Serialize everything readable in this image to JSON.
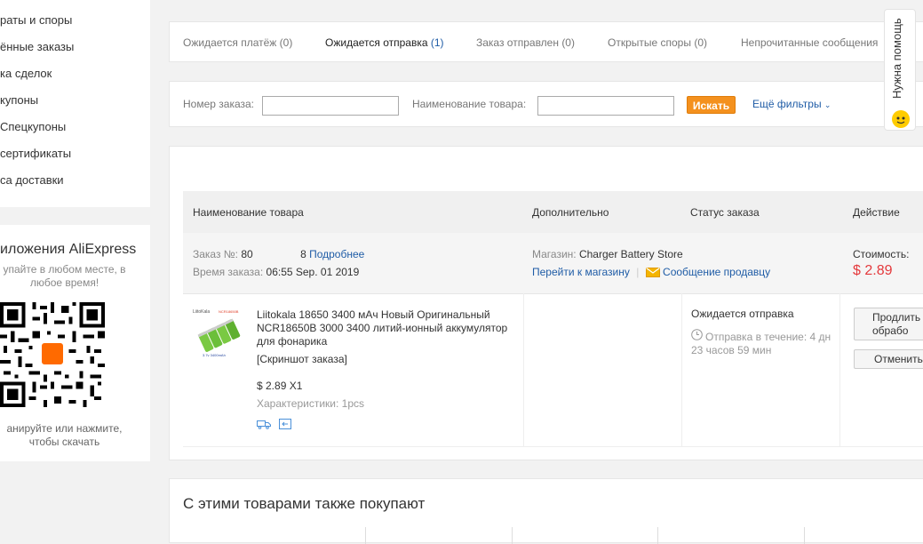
{
  "sidebar": {
    "menu_items": [
      "раты и споры",
      "ённые заказы",
      "ка сделок",
      "купоны",
      "Спецкупоны",
      "сертификаты",
      "са доставки"
    ],
    "app_title": "иложения AliExpress",
    "app_subtitle_1": "упайте в любом месте, в",
    "app_subtitle_2": "любое время!",
    "app_logo_text": "AliExpress",
    "app_footer_1": "анируйте или нажмите,",
    "app_footer_2": "чтобы скачать"
  },
  "tabs": [
    {
      "label": "Ожидается платёж",
      "count": "(0)"
    },
    {
      "label": "Ожидается отправка",
      "count": "(1)"
    },
    {
      "label": "Заказ отправлен",
      "count": "(0)"
    },
    {
      "label": "Открытые споры",
      "count": "(0)"
    },
    {
      "label": "Непрочитанные сообщения",
      "count": ""
    }
  ],
  "filter": {
    "order_number_label": "Номер заказа:",
    "order_number_value": "",
    "product_name_label": "Наименование товара:",
    "product_name_value": "",
    "search_button": "Искать",
    "more_filters": "Ещё фильтры"
  },
  "help": {
    "label": "Нужна помощь"
  },
  "table": {
    "headers": [
      "Наименование товара",
      "Дополнительно",
      "Статус заказа",
      "Действие"
    ]
  },
  "order": {
    "number_label": "Заказ №:",
    "number_value": "80                8",
    "details_link": "Подробнее",
    "time_label": "Время заказа:",
    "time_value": "06:55 Sep. 01 2019",
    "store_label": "Магазин:",
    "store_value": "Charger Battery Store",
    "go_to_store": "Перейти к магазину",
    "message_seller": "Сообщение продавцу",
    "cost_label": "Стоимость:",
    "cost_value": "$ 2.89",
    "product_name": "Liitokala 18650 3400 мАч Новый Оригинальный NCR18650B 3000 3400 литий-ионный аккумулятор для фонарика",
    "snapshot": "[Скриншот заказа]",
    "price_qty": "$ 2.89 X1",
    "specs": "Характеристики: 1pcs",
    "status": "Ожидается отправка",
    "ship_text": "Отправка в течение: 4 дн 23 часов 59 мин",
    "extend_button": "Продлить обрабо",
    "cancel_button": "Отменить",
    "image_brand": "LiitoKala",
    "image_model": "NCR18650B",
    "image_caption": "3.7v 3400mAh"
  },
  "also_bought": {
    "title": "С этими товарами также покупают"
  },
  "colors": {
    "accent": "#f4911e",
    "link": "#1f5ca6",
    "price": "#e4393c"
  }
}
